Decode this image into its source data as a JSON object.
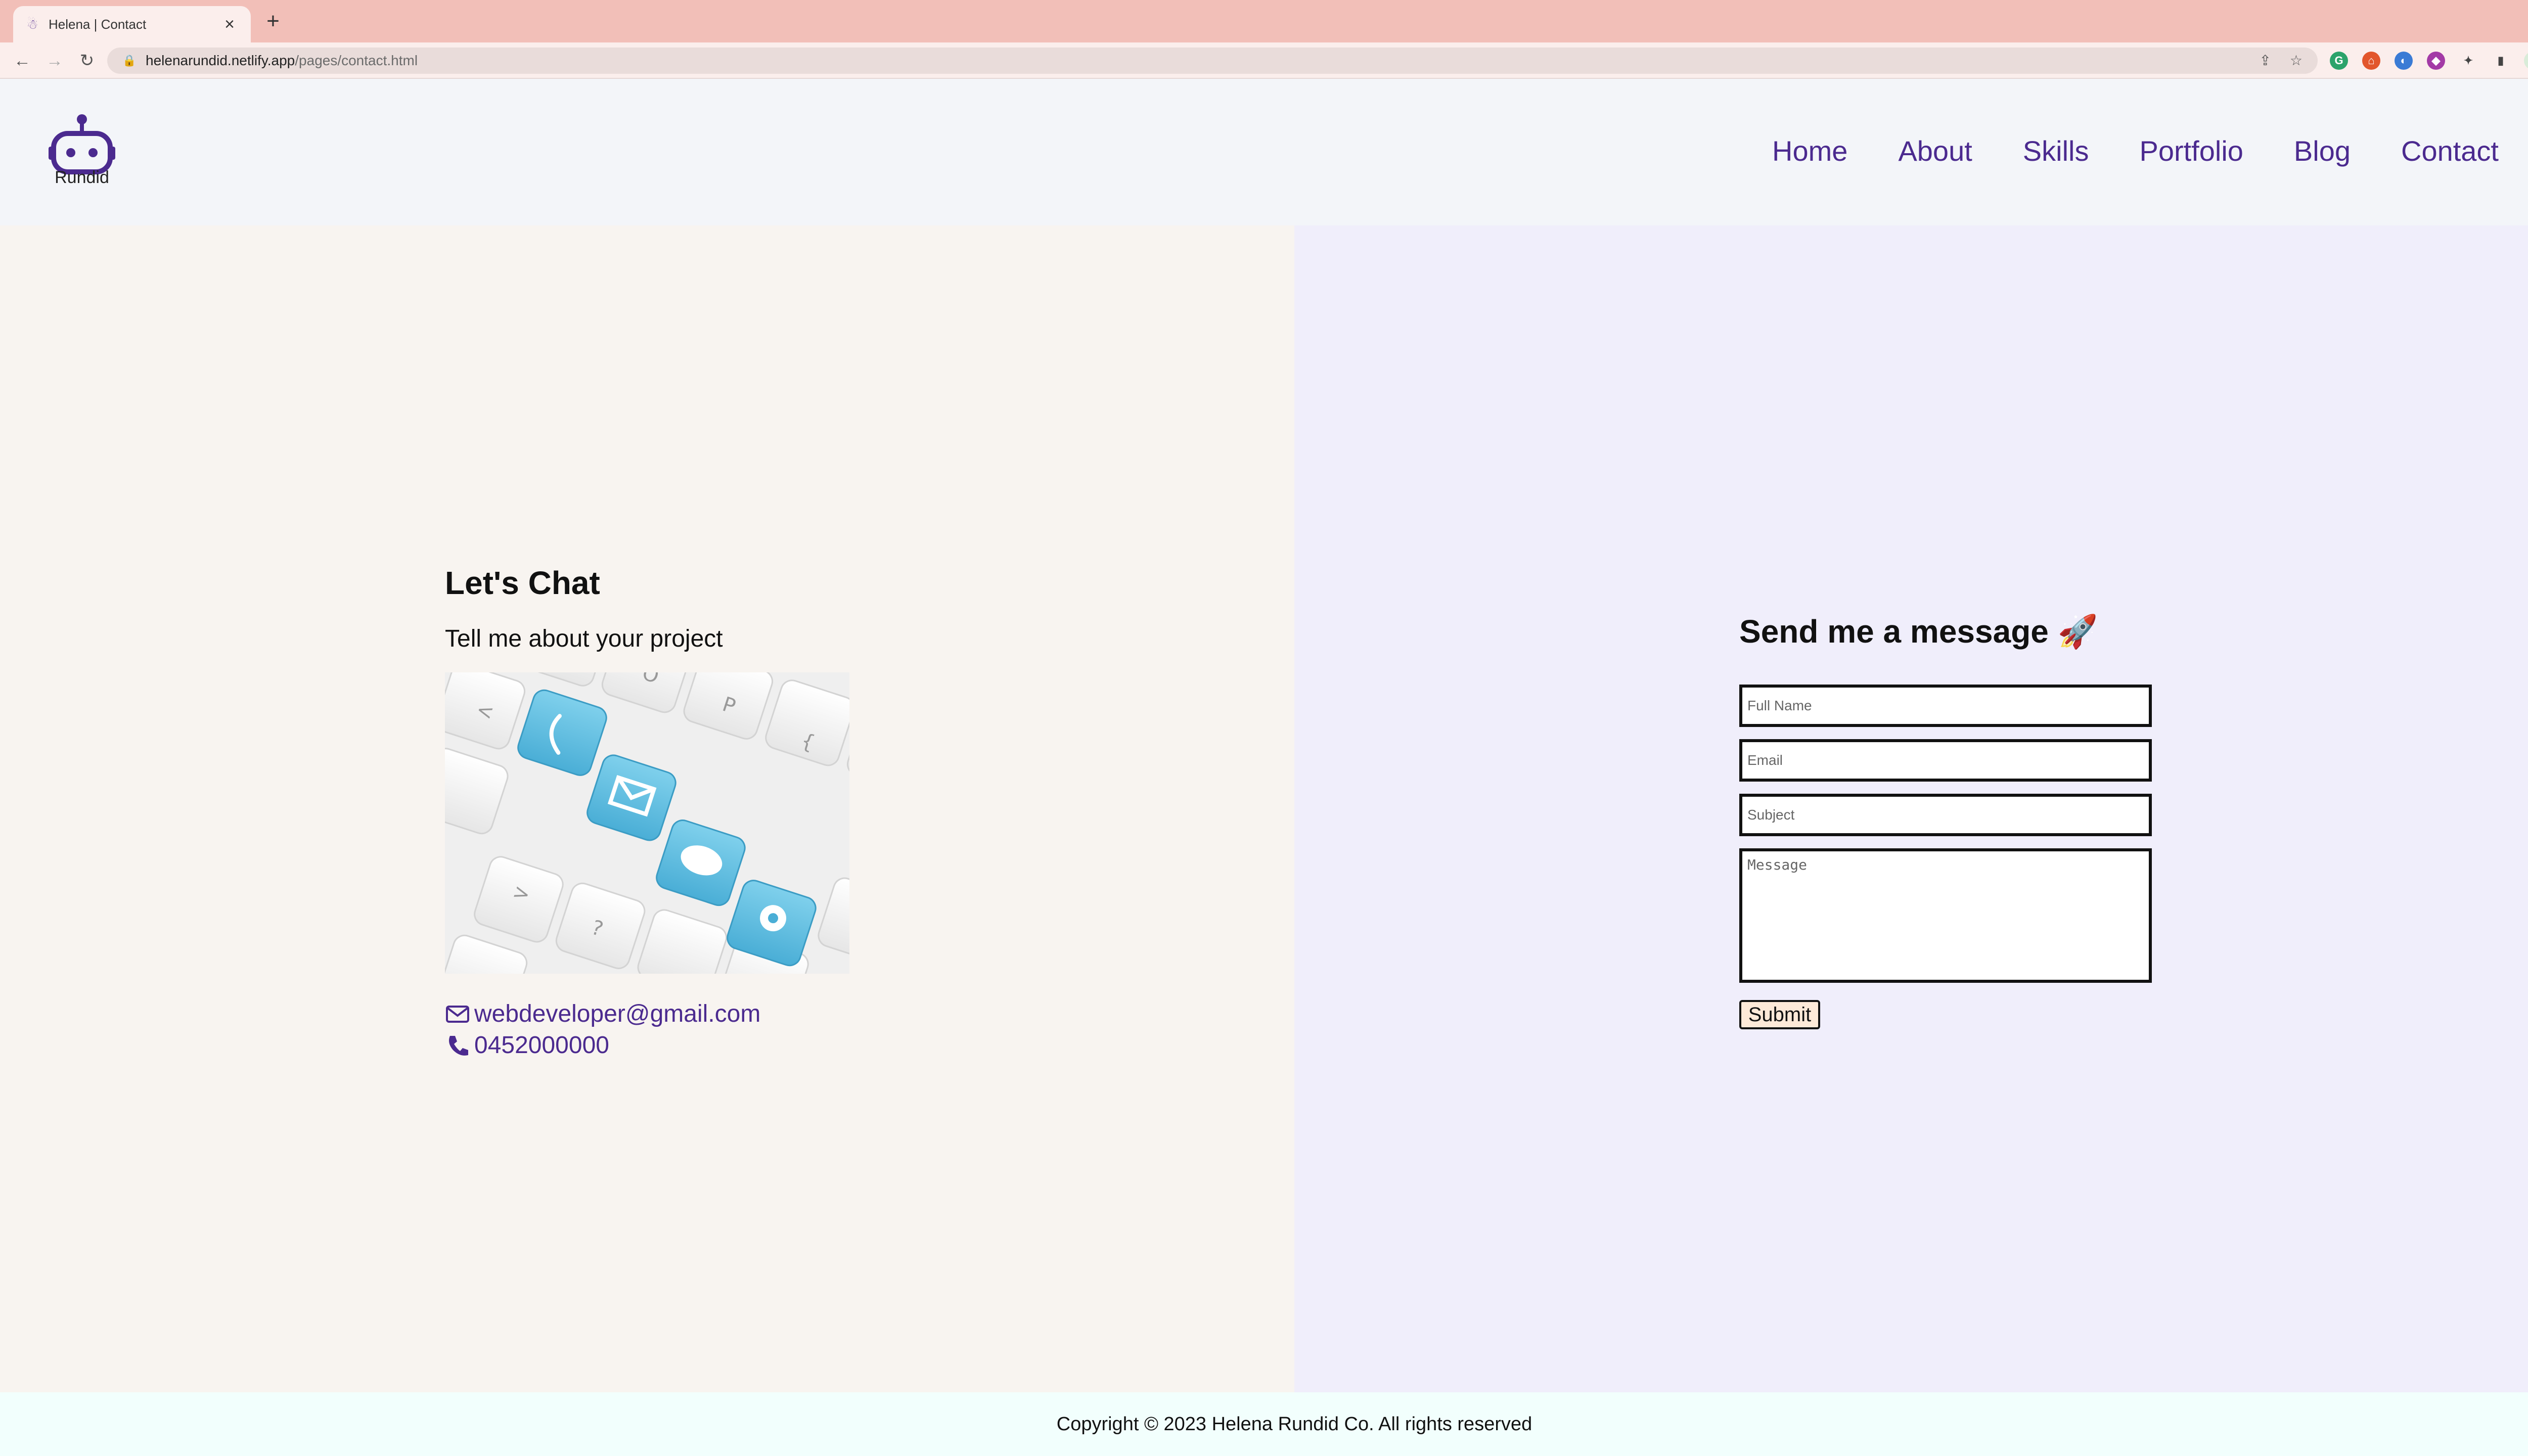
{
  "browser": {
    "tab_title": "Helena | Contact",
    "url_host": "helenarundid.netlify.app",
    "url_path": "/pages/contact.html",
    "new_tab_icon": "plus-icon"
  },
  "header": {
    "logo_text": "Rundid",
    "nav": [
      "Home",
      "About",
      "Skills",
      "Portfolio",
      "Blog",
      "Contact"
    ],
    "accent_color": "#4b2a8f"
  },
  "left": {
    "title": "Let's Chat",
    "subtitle": "Tell me about your project",
    "email": "webdeveloper@gmail.com",
    "phone": "0452000000"
  },
  "form": {
    "title": "Send me a message 🚀",
    "placeholders": {
      "name": "Full Name",
      "email": "Email",
      "subject": "Subject",
      "message": "Message"
    },
    "submit_label": "Submit"
  },
  "footer": {
    "text": "Copyright © 2023 Helena Rundid Co. All rights reserved"
  },
  "colors": {
    "tabstrip": "#f2bfb8",
    "left_panel": "#f8f4f0",
    "right_panel": "#f0eefb",
    "footer": "#f2fffd"
  }
}
